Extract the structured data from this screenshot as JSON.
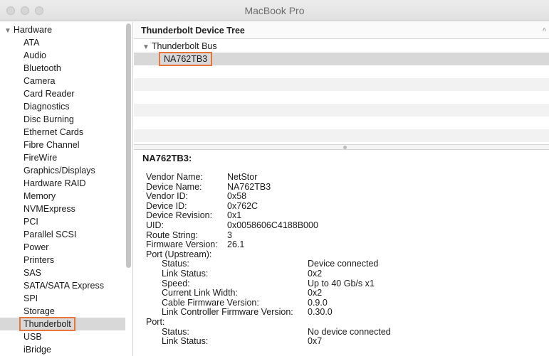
{
  "window": {
    "title": "MacBook Pro"
  },
  "sidebar": {
    "root_label": "Hardware",
    "items": [
      {
        "label": "ATA"
      },
      {
        "label": "Audio"
      },
      {
        "label": "Bluetooth"
      },
      {
        "label": "Camera"
      },
      {
        "label": "Card Reader"
      },
      {
        "label": "Diagnostics"
      },
      {
        "label": "Disc Burning"
      },
      {
        "label": "Ethernet Cards"
      },
      {
        "label": "Fibre Channel"
      },
      {
        "label": "FireWire"
      },
      {
        "label": "Graphics/Displays"
      },
      {
        "label": "Hardware RAID"
      },
      {
        "label": "Memory"
      },
      {
        "label": "NVMExpress"
      },
      {
        "label": "PCI"
      },
      {
        "label": "Parallel SCSI"
      },
      {
        "label": "Power"
      },
      {
        "label": "Printers"
      },
      {
        "label": "SAS"
      },
      {
        "label": "SATA/SATA Express"
      },
      {
        "label": "SPI"
      },
      {
        "label": "Storage"
      },
      {
        "label": "Thunderbolt",
        "selected": true
      },
      {
        "label": "USB"
      },
      {
        "label": "iBridge"
      }
    ]
  },
  "device_tree": {
    "header": "Thunderbolt Device Tree",
    "bus_label": "Thunderbolt Bus",
    "device_label": "NA762TB3"
  },
  "detail": {
    "title": "NA762TB3:",
    "properties": [
      {
        "key": "Vendor Name:",
        "value": "NetStor",
        "indent": 0
      },
      {
        "key": "Device Name:",
        "value": "NA762TB3",
        "indent": 0
      },
      {
        "key": "Vendor ID:",
        "value": "0x58",
        "indent": 0
      },
      {
        "key": "Device ID:",
        "value": "0x762C",
        "indent": 0
      },
      {
        "key": "Device Revision:",
        "value": "0x1",
        "indent": 0
      },
      {
        "key": "UID:",
        "value": "0x0058606C4188B000",
        "indent": 0
      },
      {
        "key": "Route String:",
        "value": "3",
        "indent": 0
      },
      {
        "key": "Firmware Version:",
        "value": "26.1",
        "indent": 0
      },
      {
        "key": "Port (Upstream):",
        "value": "",
        "indent": 0
      },
      {
        "key": "Status:",
        "value": "Device connected",
        "indent": 1
      },
      {
        "key": "Link Status:",
        "value": "0x2",
        "indent": 1
      },
      {
        "key": "Speed:",
        "value": "Up to 40 Gb/s x1",
        "indent": 1
      },
      {
        "key": "Current Link Width:",
        "value": "0x2",
        "indent": 1
      },
      {
        "key": "Cable Firmware Version:",
        "value": "0.9.0",
        "indent": 1
      },
      {
        "key": "Link Controller Firmware Version:",
        "value": "0.30.0",
        "indent": 1
      },
      {
        "key": "Port:",
        "value": "",
        "indent": 0
      },
      {
        "key": "Status:",
        "value": "No device connected",
        "indent": 1
      },
      {
        "key": "Link Status:",
        "value": "0x7",
        "indent": 1
      }
    ]
  },
  "colors": {
    "highlight_outline": "#e8763a",
    "selection_bg": "#d8d8d8"
  }
}
